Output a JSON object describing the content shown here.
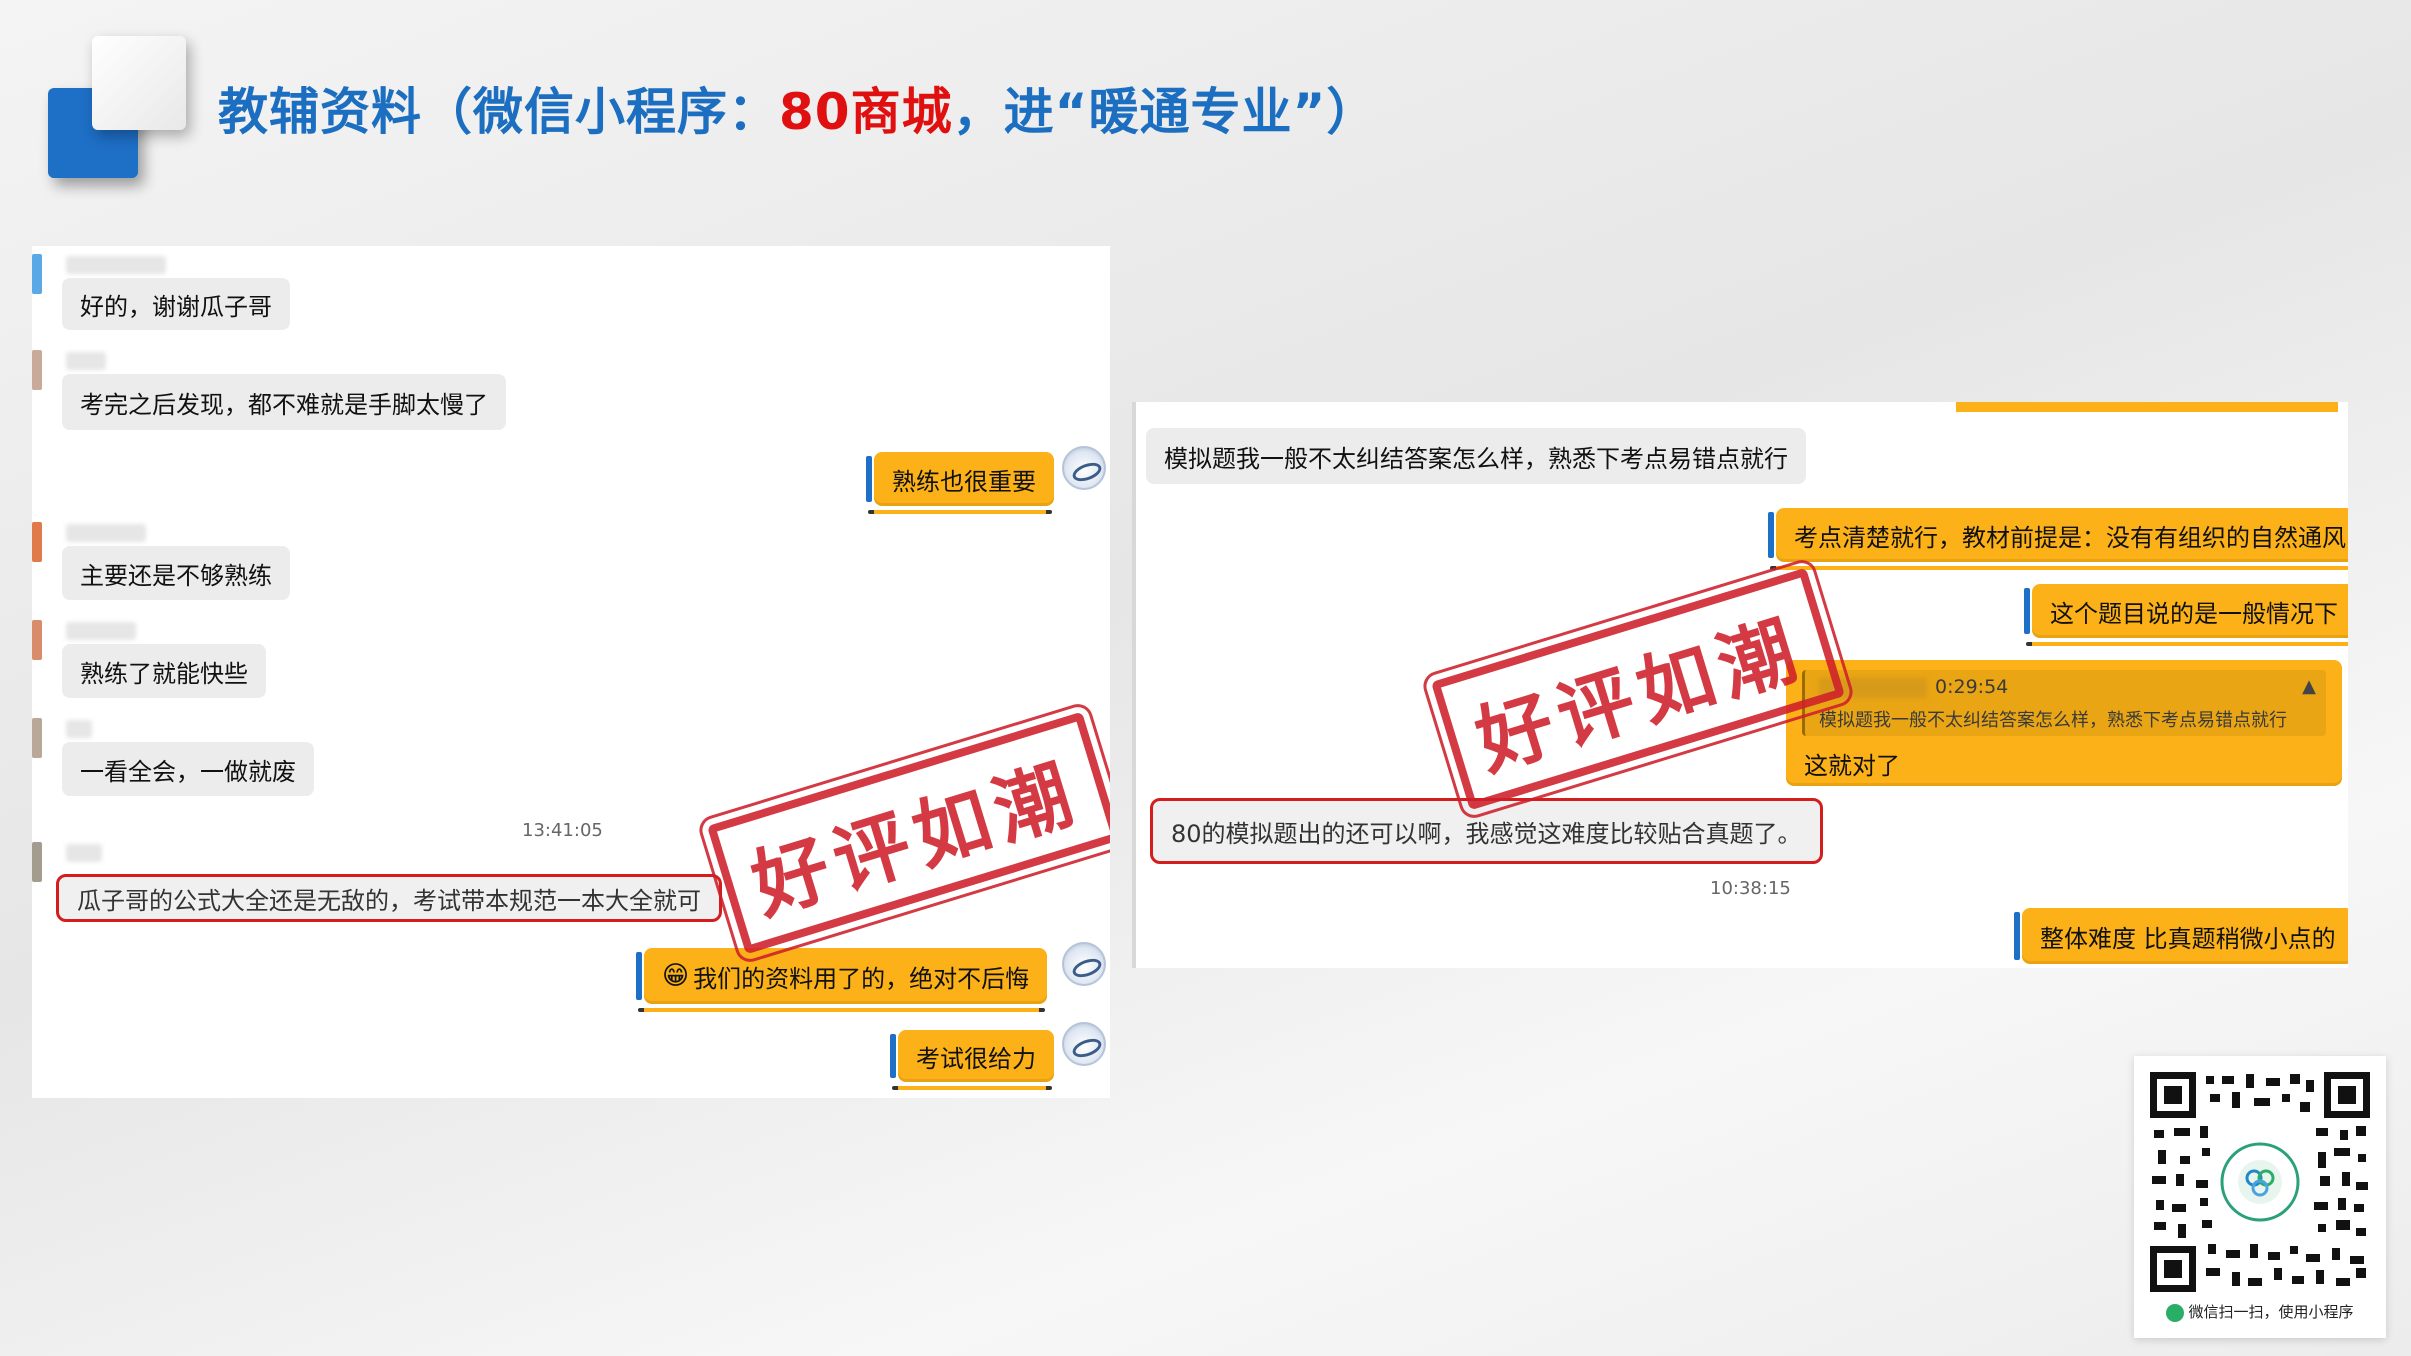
{
  "header": {
    "title_pre": "教辅资料（微信小程序：",
    "title_red": "80商城",
    "title_post": "，进“暖通专业”）"
  },
  "left_chat": {
    "messages_in": [
      "好的，谢谢瓜子哥",
      "考完之后发现，都不难就是手脚太慢了",
      "主要还是不够熟练",
      "熟练了就能快些",
      "一看全会，一做就废"
    ],
    "messages_out": [
      "熟练也很重要",
      "我们的资料用了的，绝对不后悔",
      "考试很给力"
    ],
    "timestamp": "13:41:05",
    "highlight": "瓜子哥的公式大全还是无敌的，考试带本规范一本大全就可",
    "stamp": "好评如潮"
  },
  "right_chat": {
    "message_in": "模拟题我一般不太纠结答案怎么样，熟悉下考点易错点就行",
    "messages_out": [
      "考点清楚就行，教材前提是：没有有组织的自然通风",
      "这个题目说的是一般情况下",
      "整体难度 比真题稍微小点的"
    ],
    "quote": {
      "time": "0:29:54",
      "quoted_text": "模拟题我一般不太纠结答案怎么样，熟悉下考点易错点就行",
      "reply": "这就对了"
    },
    "highlight": "80的模拟题出的还可以啊，我感觉这难度比较贴合真题了。",
    "timestamp": "10:38:15",
    "stamp": "好评如潮"
  },
  "qr": {
    "caption": "微信扫一扫，使用小程序"
  },
  "colors": {
    "accent_blue": "#1c6ec0",
    "accent_red": "#e01010",
    "bubble_orange": "#fbb117",
    "stamp_red": "#cf1f2a"
  }
}
